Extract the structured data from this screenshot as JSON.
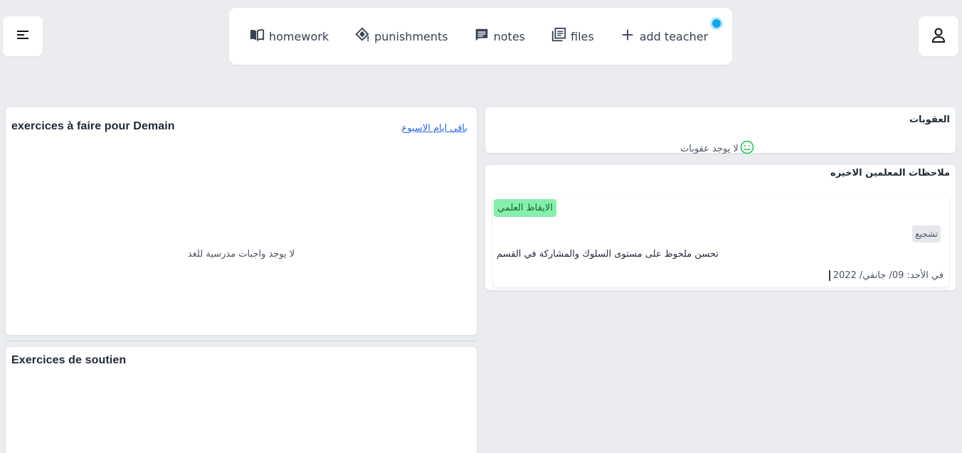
{
  "header": {
    "menu_icon": "menu-icon",
    "profile_icon": "user-icon",
    "nav": [
      {
        "label": "homework",
        "icon": "book-open-icon"
      },
      {
        "label": "punishments",
        "icon": "diamond-alert-icon"
      },
      {
        "label": "notes",
        "icon": "note-icon"
      },
      {
        "label": "files",
        "icon": "library-icon"
      },
      {
        "label": "add teacher",
        "icon": "plus-icon"
      }
    ],
    "notification_dot_color": "#0ea5e9"
  },
  "homework": {
    "title": "exercices à faire pour Demain",
    "week_link": "باقي ايام الاسبوع",
    "empty_text": "لا يوجد واجبات مدرسية للغد"
  },
  "soutien": {
    "title": "Exercices de soutien"
  },
  "punishments": {
    "title": "العقوبات",
    "empty_text": "لا يوجد عقوبات",
    "smile_icon": "smile-icon",
    "smile_color": "#22c55e"
  },
  "notes": {
    "title": "ملاحظات المعلمين الاخيره",
    "items": [
      {
        "subject": "الايقاظ العلمي",
        "type": "تشجيع",
        "text": "تحسن ملحوظ على مستوى السلوك والمشاركة في القسم",
        "date": "في الأحد: 09/ جانفي/ 2022"
      }
    ]
  },
  "colors": {
    "background": "#ebecf0",
    "link": "#2563eb",
    "subject_badge": "#86efac",
    "type_badge": "#e5e7eb"
  }
}
